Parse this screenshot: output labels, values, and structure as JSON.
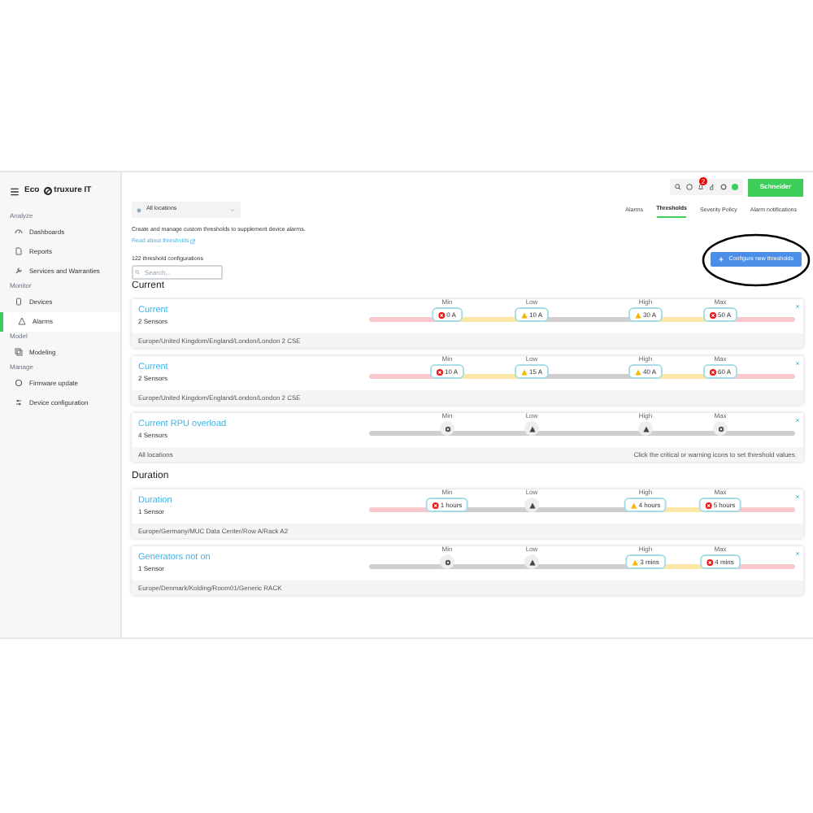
{
  "sidebar": {
    "brand_left": "Eco",
    "brand_right": "truxure IT",
    "sections": [
      {
        "label": "Analyze",
        "items": [
          {
            "label": "Dashboards",
            "selected": false
          },
          {
            "label": "Reports",
            "selected": false
          },
          {
            "label": "Services and Warranties",
            "selected": false
          }
        ]
      },
      {
        "label": "Monitor",
        "items": [
          {
            "label": "Devices",
            "selected": false
          },
          {
            "label": "Alarms",
            "selected": true
          }
        ]
      },
      {
        "label": "Model",
        "items": [
          {
            "label": "Modeling",
            "selected": false
          }
        ]
      },
      {
        "label": "Manage",
        "items": [
          {
            "label": "Firmware update",
            "selected": false
          },
          {
            "label": "Device configuration",
            "selected": false
          }
        ]
      }
    ]
  },
  "header": {
    "brand": "Schneider",
    "notification_badge": "2"
  },
  "location_filter": "All locations",
  "tabs": [
    {
      "label": "Alarms",
      "selected": false
    },
    {
      "label": "Thresholds",
      "selected": true
    },
    {
      "label": "Severity Policy",
      "selected": false
    },
    {
      "label": "Alarm notifications",
      "selected": false
    }
  ],
  "description": "Create and manage custom thresholds to supplement device alarms.",
  "help_link": "Read about thresholds",
  "count": "122 threshold configurations",
  "search": {
    "placeholder": "Search..."
  },
  "configure_button": "Configure new thresholds",
  "groups": [
    {
      "title": "Current",
      "cards": [
        {
          "title": "Current",
          "sensors": "2 Sensors",
          "location": "Europe/United Kingdom/England/London/London 2 CSE",
          "markers": [
            {
              "label": "Min",
              "kind": "critical",
              "value": "0 A"
            },
            {
              "label": "Low",
              "kind": "warning",
              "value": "10 A"
            },
            {
              "label": "High",
              "kind": "warning",
              "value": "30 A"
            },
            {
              "label": "Max",
              "kind": "critical",
              "value": "50 A"
            }
          ]
        },
        {
          "title": "Current",
          "sensors": "2 Sensors",
          "location": "Europe/United Kingdom/England/London/London 2 CSE",
          "markers": [
            {
              "label": "Min",
              "kind": "critical",
              "value": "10 A"
            },
            {
              "label": "Low",
              "kind": "warning",
              "value": "15 A"
            },
            {
              "label": "High",
              "kind": "warning",
              "value": "40 A"
            },
            {
              "label": "Max",
              "kind": "critical",
              "value": "60 A"
            }
          ]
        },
        {
          "title": "Current RPU overload",
          "sensors": "4 Sensors",
          "location": "All locations",
          "note": "Click the critical or warning icons to set threshold values.",
          "markers": [
            {
              "label": "Min",
              "kind": "critical"
            },
            {
              "label": "Low",
              "kind": "warning"
            },
            {
              "label": "High",
              "kind": "warning"
            },
            {
              "label": "Max",
              "kind": "critical"
            }
          ]
        }
      ]
    },
    {
      "title": "Duration",
      "cards": [
        {
          "title": "Duration",
          "sensors": "1 Sensor",
          "location": "Europe/Germany/MUC Data Center/Row A/Rack A2",
          "markers": [
            {
              "label": "Min",
              "kind": "critical",
              "value": "1 hours"
            },
            {
              "label": "Low",
              "kind": "warning"
            },
            {
              "label": "High",
              "kind": "warning",
              "value": "4 hours"
            },
            {
              "label": "Max",
              "kind": "critical",
              "value": "5 hours"
            }
          ]
        },
        {
          "title": "Generators not on",
          "sensors": "1 Sensor",
          "location": "Europe/Denmark/Kolding/Room01/Generic RACK",
          "markers": [
            {
              "label": "Min",
              "kind": "critical"
            },
            {
              "label": "Low",
              "kind": "warning"
            },
            {
              "label": "High",
              "kind": "warning",
              "value": "3 mins"
            },
            {
              "label": "Max",
              "kind": "critical",
              "value": "4 mins"
            }
          ]
        }
      ]
    }
  ]
}
